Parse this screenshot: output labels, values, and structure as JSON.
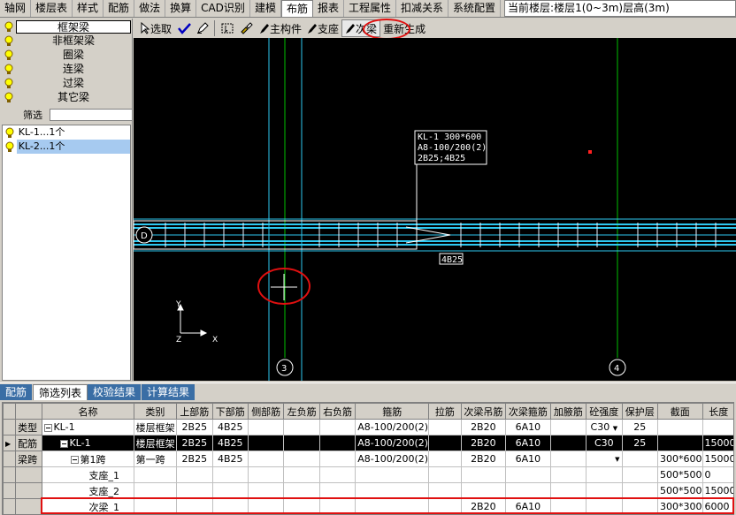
{
  "menu": {
    "items": [
      "轴网",
      "楼层表",
      "样式",
      "配筋",
      "做法",
      "换算",
      "CAD识别",
      "建模",
      "布筋",
      "报表",
      "工程属性",
      "扣减关系",
      "系统配置"
    ],
    "active_index": 8,
    "floor_info": "当前楼层:楼层1(0~3m)层高(3m)"
  },
  "left_panel": {
    "types": [
      "框架梁",
      "非框架梁",
      "圈梁",
      "连梁",
      "过梁",
      "其它梁"
    ],
    "selected_type": 0,
    "filter_label": "筛选",
    "components": [
      "KL-1...1个",
      "KL-2...1个"
    ],
    "selected_component": 1
  },
  "toolbar": {
    "select": "选取",
    "main_member": "主构件",
    "support": "支座",
    "secondary_beam": "次梁",
    "regenerate": "重新生成"
  },
  "canvas": {
    "beam_label_lines": [
      "KL-1 300*600",
      "A8-100/200(2)",
      "2B25;4B25"
    ],
    "bottom_label": "4B25",
    "axis_d": "D",
    "axis_3": "3",
    "axis_4": "4",
    "ucs_y": "Y",
    "ucs_z": "Z",
    "ucs_x": "X",
    "colors": {
      "beam": "#2ec8f0",
      "grid": "#00c000",
      "text": "#ffffff"
    }
  },
  "bottom_tabs": [
    "配筋",
    "筛选列表",
    "校验结果",
    "计算结果"
  ],
  "active_bottom_tab": 1,
  "table": {
    "headers": [
      "名称",
      "类别",
      "上部筋",
      "下部筋",
      "侧部筋",
      "左负筋",
      "右负筋",
      "箍筋",
      "拉筋",
      "次梁吊筋",
      "次梁箍筋",
      "加腋筋",
      "砼强度",
      "保护层",
      "截面",
      "长度"
    ],
    "rows": [
      {
        "head": "类型",
        "name": "KL-1",
        "type": "楼层框架",
        "top": "2B25",
        "bottom": "4B25",
        "side": "",
        "left": "",
        "right": "",
        "stirrup": "A8-100/200(2)",
        "tie": "",
        "hang": "2B20",
        "sec_stirrup": "6A10",
        "haunch": "",
        "concrete": "C30",
        "cover": "25",
        "section": "",
        "length": ""
      },
      {
        "head": "配筋",
        "name": "KL-1",
        "type": "楼层框架",
        "top": "2B25",
        "bottom": "4B25",
        "side": "",
        "left": "",
        "right": "",
        "stirrup": "A8-100/200(2)",
        "tie": "",
        "hang": "2B20",
        "sec_stirrup": "6A10",
        "haunch": "",
        "concrete": "C30",
        "cover": "25",
        "section": "",
        "length": "15000"
      },
      {
        "head": "梁跨",
        "name": "第1跨",
        "type": "第一跨",
        "top": "2B25",
        "bottom": "4B25",
        "side": "",
        "left": "",
        "right": "",
        "stirrup": "A8-100/200(2)",
        "tie": "",
        "hang": "2B20",
        "sec_stirrup": "6A10",
        "haunch": "",
        "concrete": "",
        "cover": "",
        "section": "300*600",
        "length": "15000"
      },
      {
        "head": "",
        "name": "支座_1",
        "type": "",
        "top": "",
        "bottom": "",
        "side": "",
        "left": "",
        "right": "",
        "stirrup": "",
        "tie": "",
        "hang": "",
        "sec_stirrup": "",
        "haunch": "",
        "concrete": "",
        "cover": "",
        "section": "500*500",
        "length": "0"
      },
      {
        "head": "",
        "name": "支座_2",
        "type": "",
        "top": "",
        "bottom": "",
        "side": "",
        "left": "",
        "right": "",
        "stirrup": "",
        "tie": "",
        "hang": "",
        "sec_stirrup": "",
        "haunch": "",
        "concrete": "",
        "cover": "",
        "section": "500*500",
        "length": "15000"
      },
      {
        "head": "",
        "name": "次梁_1",
        "type": "",
        "top": "",
        "bottom": "",
        "side": "",
        "left": "",
        "right": "",
        "stirrup": "",
        "tie": "",
        "hang": "2B20",
        "sec_stirrup": "6A10",
        "haunch": "",
        "concrete": "",
        "cover": "",
        "section": "300*300",
        "length": "6000"
      }
    ]
  }
}
